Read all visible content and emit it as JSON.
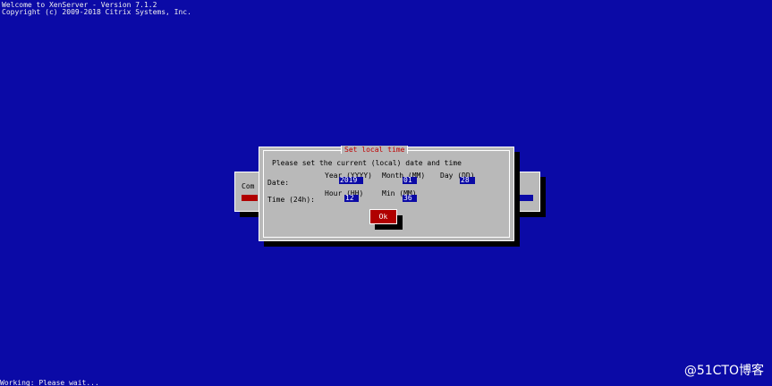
{
  "header": {
    "welcome": "Welcome to XenServer - Version 7.1.2",
    "copyright": "Copyright (c) 2009-2018 Citrix Systems, Inc."
  },
  "background_dialog": {
    "label": "Com"
  },
  "dialog": {
    "title": "Set local time",
    "prompt": "Please set the current (local) date and time",
    "date_label": "Date:",
    "time_label": "Time (24h):",
    "year_label": "Year (YYYY)",
    "month_label": "Month (MM)",
    "day_label": "Day (DD)",
    "hour_label": "Hour (HH)",
    "min_label": "Min (MM)",
    "year_value": "2019",
    "month_value": "01",
    "day_value": "28",
    "hour_value": "12",
    "min_value": "36",
    "ok_label": "Ok"
  },
  "status": {
    "bottom_text": "Working: Please wait..."
  },
  "watermark": "@51CTO博客",
  "colors": {
    "background": "#0b0aa6",
    "dialog": "#b9b9b9",
    "title": "#c00000",
    "button": "#b00000",
    "field": "#0b0aa6"
  }
}
